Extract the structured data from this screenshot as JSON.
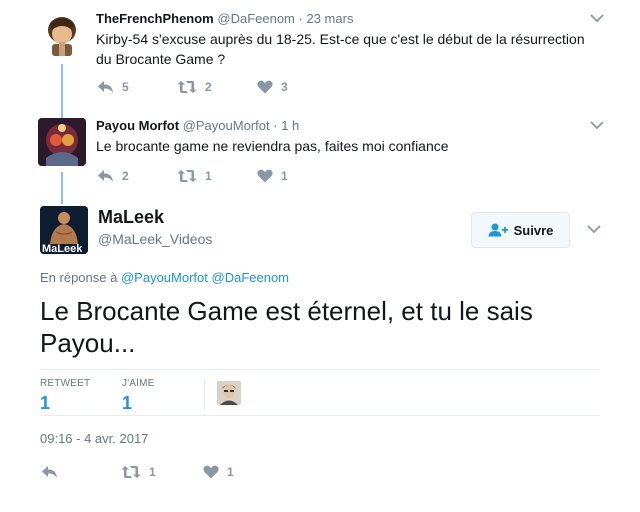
{
  "tweets": [
    {
      "name": "TheFrenchPhenom",
      "handle": "@DaFeenom",
      "separator": "·",
      "time": "23 mars",
      "text": "Kirby-54 s'excuse auprès du 18-25. Est-ce que c'est le début de la résurrection du Brocante Game ?",
      "replies": "5",
      "retweets": "2",
      "likes": "3"
    },
    {
      "name": "Payou Morfot",
      "handle": "@PayouMorfot",
      "separator": "·",
      "time": "1 h",
      "text": "Le brocante game ne reviendra pas, faites moi confiance",
      "replies": "2",
      "retweets": "1",
      "likes": "1"
    }
  ],
  "main": {
    "name": "MaLeek",
    "handle": "@MaLeek_Videos",
    "avatar_text": "MaLeek",
    "follow_label": "Suivre",
    "reply_prefix": "En réponse à",
    "reply_mentions": [
      "@PayouMorfot",
      "@DaFeenom"
    ],
    "text": "Le Brocante Game est éternel, et tu le sais Payou...",
    "stats": {
      "retweet_label": "RETWEET",
      "retweet_count": "1",
      "like_label": "J'AIME",
      "like_count": "1"
    },
    "timestamp": "09:16 - 4 avr. 2017",
    "actions": {
      "retweets": "1",
      "likes": "1"
    }
  },
  "colors": {
    "accent": "#1b95e0",
    "thread_line": "#7fc6e8",
    "muted": "#657786",
    "icon": "#8899a6"
  },
  "icons": [
    "reply-icon",
    "retweet-icon",
    "heart-icon",
    "chevron-down-icon",
    "follow-icon"
  ]
}
